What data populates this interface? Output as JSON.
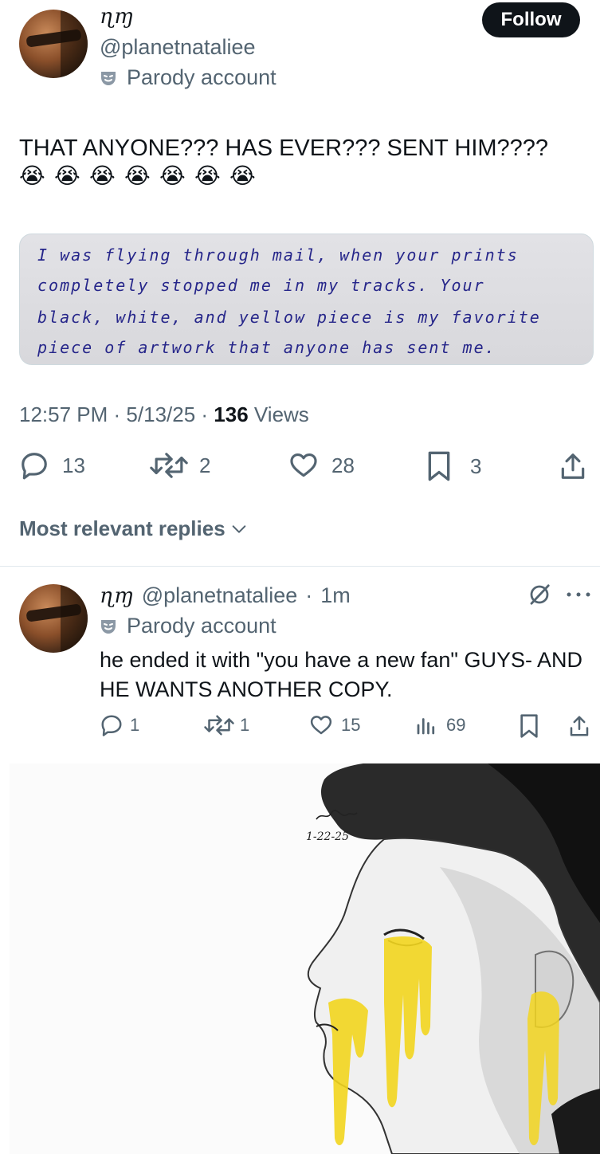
{
  "tweet": {
    "display_name": "ɳɱ",
    "handle": "@planetnataliee",
    "parody_label": "Parody account",
    "follow_label": "Follow",
    "text": "THAT ANYONE??? HAS EVER??? SENT HIM????",
    "emoji": [
      "😭",
      "😭",
      "😭",
      "😭",
      "😭",
      "😭",
      "😭"
    ],
    "image_text": [
      "I was flying through mail, when your prints",
      "completely stopped me in my tracks. Your",
      "black, white, and yellow piece is my favorite",
      "piece of artwork that anyone has sent me."
    ],
    "time": "12:57 PM",
    "date": "5/13/25",
    "views_count": "136",
    "views_label": "Views",
    "replies": "13",
    "reposts": "2",
    "likes": "28",
    "bookmarks": "3"
  },
  "replies_sort": {
    "label": "Most relevant replies"
  },
  "reply": {
    "display_name": "ɳɱ",
    "handle": "@planetnataliee",
    "age": "1m",
    "parody_label": "Parody account",
    "text": "he ended it with \"you have a new fan\" GUYS- AND HE WANTS ANOTHER COPY.",
    "replies": "1",
    "reposts": "1",
    "likes": "15",
    "views": "69"
  },
  "portrait_signature": {
    "date": "1-22-25"
  },
  "colors": {
    "text": "#0f1419",
    "muted": "#536471",
    "ink": "#26268a",
    "accent_yellow": "#f2d51e"
  }
}
